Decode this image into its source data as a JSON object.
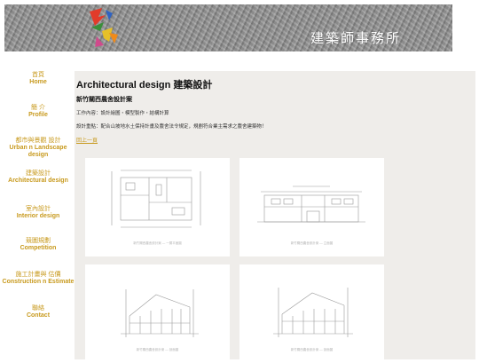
{
  "header": {
    "logo_alt": "logo",
    "title": "建築師事務所"
  },
  "sidebar": {
    "items": [
      {
        "zh": "首頁",
        "en": "Home"
      },
      {
        "zh": "簡 介",
        "en": "Profile"
      },
      {
        "zh": "都市與景觀 設計",
        "en": "Urban n Landscape design"
      },
      {
        "zh": "建築設計",
        "en": "Architectural design"
      },
      {
        "zh": "室內設計",
        "en": "Interior design"
      },
      {
        "zh": "競圖規劃",
        "en": "Competition"
      },
      {
        "zh": "施工計畫與 估價",
        "en": "Construction n Estimate"
      },
      {
        "zh": "聯絡",
        "en": "Contact"
      }
    ]
  },
  "main": {
    "title": "Architectural design  建築設計",
    "project_title": "新竹關西農舍設計案",
    "desc_line1": "工作內容：設計繪圖・模型製作・結構計算",
    "desc_line2": "設計重點：配合山坡地水土保持計畫及農舍法令規定，規劃符合業主需求之農舍建築物！",
    "back_link": "回上一頁",
    "drawings": [
      {
        "caption": "新竹關西農舍設計案 — 一層平面圖"
      },
      {
        "caption": "新竹關西農舍設計案 — 立面圖"
      },
      {
        "caption": "新竹關西農舍設計案 — 剖面圖"
      },
      {
        "caption": "新竹關西農舍設計案 — 剖面圖"
      }
    ]
  },
  "colors": {
    "accent": "#c89a1e",
    "panel": "#efedea",
    "banner": "#8e8e8e"
  }
}
